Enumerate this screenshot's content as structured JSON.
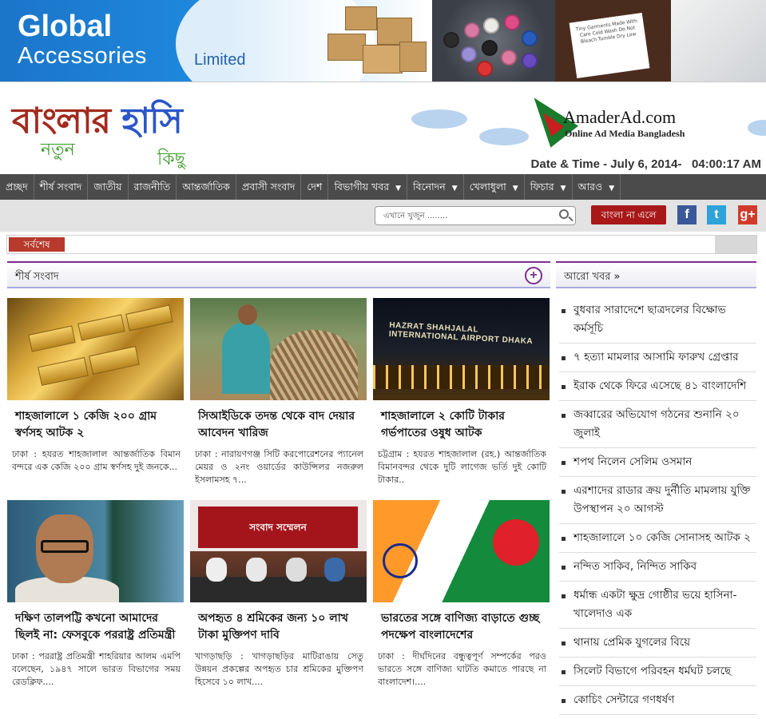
{
  "banner": {
    "line1": "Global",
    "line2": "Accessories",
    "line3": "Limited"
  },
  "logo": {
    "main_a": "বাংলার",
    "main_b": "হাসি",
    "sub1": "নতুন",
    "sub2": "কিছু"
  },
  "amaderad": {
    "name": "AmaderAd.com",
    "tagline": "Online Ad Media Bangladesh"
  },
  "datetime": "Date & Time - July 6, 2014-   04:00:17 AM",
  "nav": [
    {
      "label": "প্রচ্ছদ",
      "dropdown": false
    },
    {
      "label": "শীর্ষ সংবাদ",
      "dropdown": false
    },
    {
      "label": "জাতীয়",
      "dropdown": false
    },
    {
      "label": "রাজনীতি",
      "dropdown": false
    },
    {
      "label": "আন্তর্জাতিক",
      "dropdown": false
    },
    {
      "label": "প্রবাসী সংবাদ",
      "dropdown": false
    },
    {
      "label": "দেশ",
      "dropdown": false
    },
    {
      "label": "বিভাগীয় খবর",
      "dropdown": true
    },
    {
      "label": "বিনোদন",
      "dropdown": true
    },
    {
      "label": "খেলাধুলা",
      "dropdown": true
    },
    {
      "label": "ফিচার",
      "dropdown": true
    },
    {
      "label": "আরও",
      "dropdown": true
    }
  ],
  "search": {
    "placeholder": "এখানে খুজুন ........"
  },
  "bangla_button": "বাংলা না এলে",
  "social": {
    "facebook": "f",
    "twitter": "t",
    "gplus": "g+"
  },
  "ticker": {
    "label": "সর্বশেষ"
  },
  "sections": {
    "top_news": "শীর্ষ সংবাদ",
    "more_news": "আরো খবর »",
    "plus": "+"
  },
  "cards": [
    {
      "title": "শাহজালালে ১ কেজি ২০০ গ্রাম স্বর্ণসহ আটক ২",
      "excerpt": "ঢাকা : হযরত শাহজালাল আন্তর্জাতিক বিমান বন্দরে এক কেজি ২০০ গ্রাম স্বর্ণসহ দুই জনকে..."
    },
    {
      "title": "সিআইডিকে তদন্ত থেকে বাদ দেয়ার আবেদন খারিজ",
      "excerpt": "ঢাকা : নারায়ণগঞ্জ সিটি করপোরেশনের প্যানেল মেয়র ও ২নং ওয়ার্ডের কাউন্সিলর নজরুল ইসলামসহ ৭..."
    },
    {
      "title": "শাহজালালে ২ কোটি টাকার গর্ভপাতের ওষুধ আটক",
      "excerpt": "চট্টগ্রাম : হযরত শাহজালাল (রহ.) আন্তর্জাতিক বিমানবন্দর থেকে দুটি লাগেজ ভর্তি দুই কোটি টাকার..",
      "image_text": "HAZRAT SHAHJALAL INTERNATIONAL AIRPORT DHAKA"
    },
    {
      "title": "দক্ষিণ তালপট্টি কখনো আমাদের ছিলই না: ফেসবুকে পররাষ্ট্র প্রতিমন্ত্রী",
      "excerpt": "ঢাকা : পররাষ্ট্র প্রতিমন্ত্রী শাহরিয়ার আলম এমপি বলেছেন, ১৯৪৭ সালে ভারত বিভাগের সময় রেডক্লিফ...."
    },
    {
      "title": "অপহৃত ৪ শ্রমিকের জন্য ১০ লাখ টাকা মুক্তিপণ দাবি",
      "excerpt": "খাগড়াছড়ি : খাগড়াছড়ির মাটিরাঙায় সেতু উন্নয়ন প্রকল্পের অপহৃত চার শ্রমিকের মুক্তিপণ হিসেবে ১০ লাখ....",
      "image_text": "সংবাদ সম্মেলন"
    },
    {
      "title": "ভারতের সঙ্গে বাণিজ্য বাড়াতে গুচ্ছ পদক্ষেপ বাংলাদেশের",
      "excerpt": "ঢাকা : দীর্ঘদিনের বন্ধুত্বপূর্ণ সম্পর্কের পরও ভারতে সঙ্গে বাণিজ্য ঘাটতি কমাতে পারছে না বাংলাদেশ।...."
    }
  ],
  "more_news": [
    "বুধবার সারাদেশে ছাত্রদলের বিক্ষোভ কর্মসূচি",
    "৭ হত্যা মামলার আসামি ফারুখ গ্রেপ্তার",
    "ইরাক থেকে ফিরে এসেছে ৪১ বাংলাদেশি",
    "জব্বারের অভিযোগ গঠনের শুনানি ২০ জুলাই",
    "শপথ নিলেন সেলিম ওসমান",
    "এরশাদের রাডার ক্রয় দুর্নীতি মামলায় যুক্তি উপস্থাপন ২০ আগস্ট",
    "শাহজালালে ১০ কেজি সোনাসহ আটক ২",
    "নন্দিত সাকিব, নিন্দিত সাকিব",
    "ধর্মান্ধ একটা ক্ষুদ্র গোষ্ঠীর ভয়ে হাসিনা-খালেদাও এক",
    "থানায় প্রেমিক যুগলের বিয়ে",
    "সিলেট বিভাগে পরিবহন ধর্মঘট চলছে",
    "কোচিং সেন্টারে গণধর্ষণ"
  ]
}
